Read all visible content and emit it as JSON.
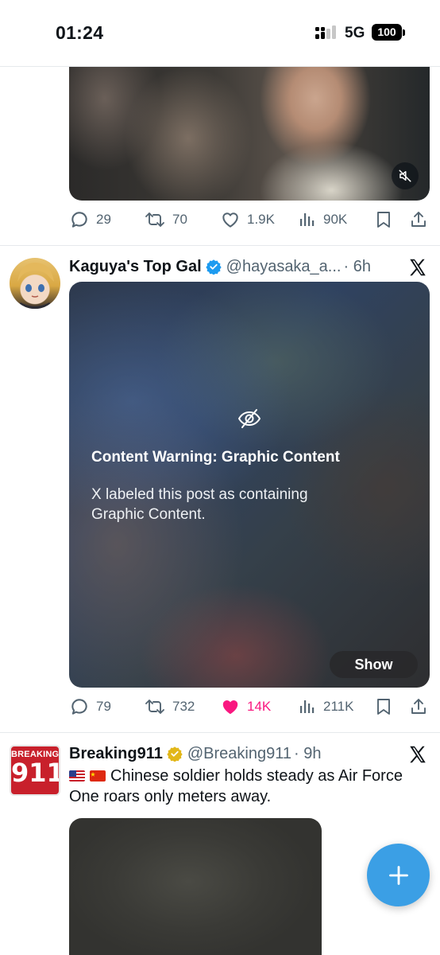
{
  "status_bar": {
    "time": "01:24",
    "network": "5G",
    "battery": "100"
  },
  "post1": {
    "stats": {
      "replies": "29",
      "reposts": "70",
      "likes": "1.9K",
      "views": "90K"
    }
  },
  "post2": {
    "name": "Kaguya's Top Gal",
    "handle": "@hayasaka_a...",
    "time": "· 6h",
    "warning_title": "Content Warning: Graphic Content",
    "warning_desc": "X labeled this post as containing Graphic Content.",
    "show_label": "Show",
    "stats": {
      "replies": "79",
      "reposts": "732",
      "likes": "14K",
      "views": "211K"
    }
  },
  "post3": {
    "avatar_text_top": "BREAKING",
    "avatar_text_bottom": "911",
    "name": "Breaking911",
    "handle": "@Breaking911",
    "time": "· 9h",
    "text": "Chinese soldier holds steady as Air Force One roars only meters away."
  },
  "colors": {
    "accent": "#1d9bf0",
    "like_active": "#f91880",
    "muted": "#536471",
    "fab": "#3b9fe5"
  }
}
